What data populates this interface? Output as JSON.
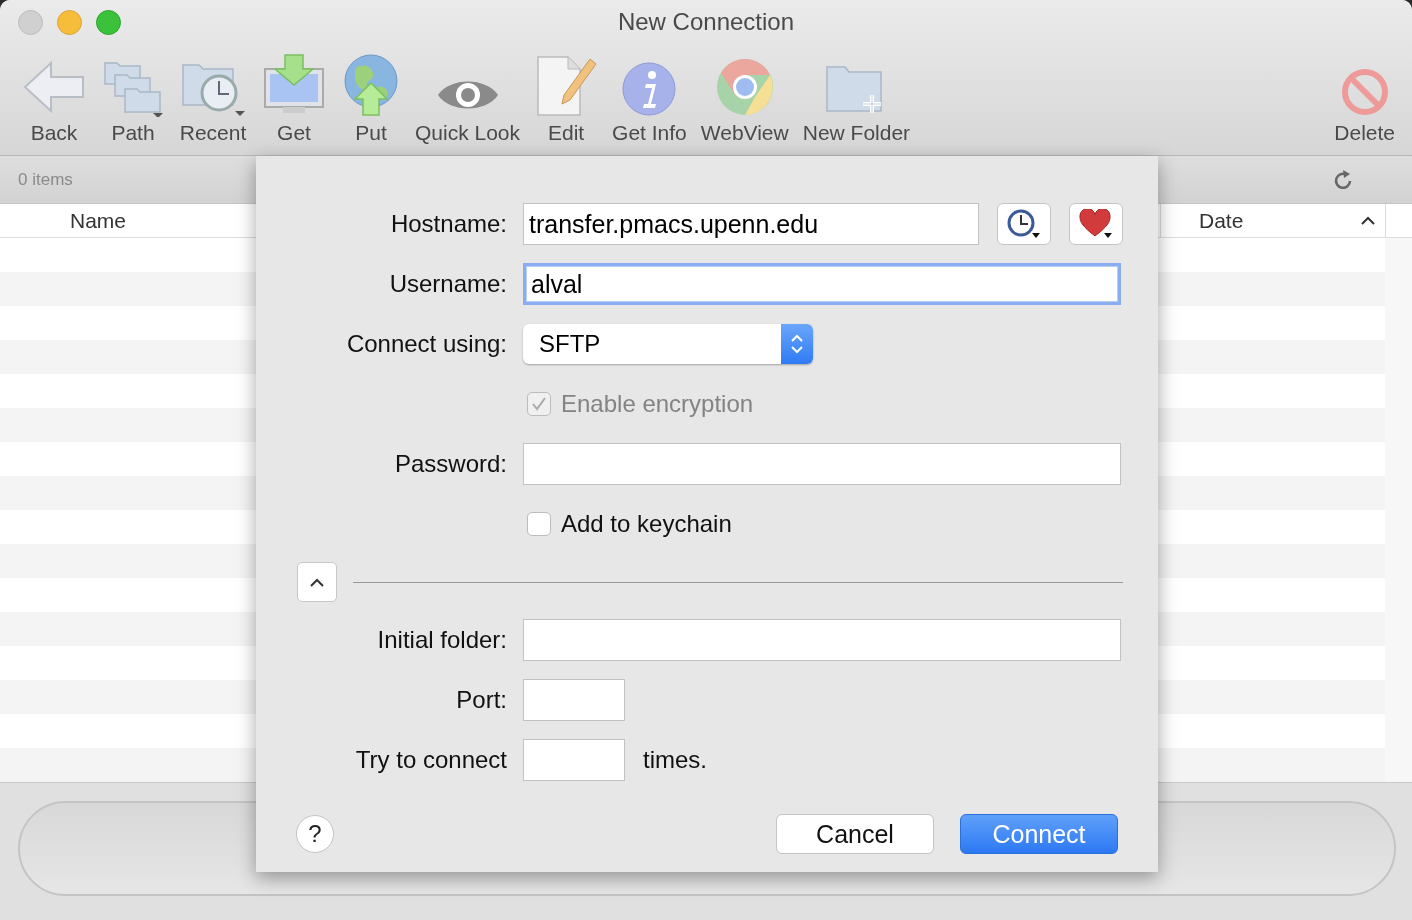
{
  "window": {
    "title": "New Connection"
  },
  "toolbar": [
    {
      "label": "Back",
      "kind": "back"
    },
    {
      "label": "Path",
      "kind": "path"
    },
    {
      "label": "Recent",
      "kind": "recent"
    },
    {
      "label": "Get",
      "kind": "get"
    },
    {
      "label": "Put",
      "kind": "put"
    },
    {
      "label": "Quick Look",
      "kind": "eye"
    },
    {
      "label": "Edit",
      "kind": "edit"
    },
    {
      "label": "Get Info",
      "kind": "info"
    },
    {
      "label": "WebView",
      "kind": "web"
    },
    {
      "label": "New Folder",
      "kind": "newfolder"
    },
    {
      "label": "Delete",
      "kind": "delete"
    }
  ],
  "browser": {
    "status": "0 items",
    "columns": [
      {
        "label": "Name",
        "sorted": false
      },
      {
        "label": "Date",
        "sorted": true
      }
    ]
  },
  "dialog": {
    "rows": [
      {
        "kind": "text",
        "label": "Hostname:",
        "value": "transfer.pmacs.upenn.edu",
        "focused": false,
        "history_button": true
      },
      {
        "kind": "text",
        "label": "Username:",
        "value": "alval",
        "focused": true
      },
      {
        "kind": "select",
        "label": "Connect using:",
        "value": "SFTP"
      },
      {
        "kind": "checkbox",
        "label": "Enable encryption",
        "checked": true,
        "disabled": true
      },
      {
        "kind": "text",
        "label": "Password:",
        "focused": false
      },
      {
        "kind": "checkbox",
        "label": "Add to keychain",
        "checked": false,
        "disabled": false
      },
      {
        "kind": "disclosure",
        "expanded": true
      },
      {
        "kind": "text",
        "label": "Initial folder:",
        "focused": false
      },
      {
        "kind": "short_text",
        "label": "Port:",
        "focused": false
      },
      {
        "kind": "short_text",
        "label": "Try to connect",
        "focused": false,
        "suffix": "times."
      }
    ],
    "help": "?",
    "buttons": [
      {
        "label": "Cancel",
        "default": false
      },
      {
        "label": "Connect",
        "default": true
      }
    ]
  }
}
